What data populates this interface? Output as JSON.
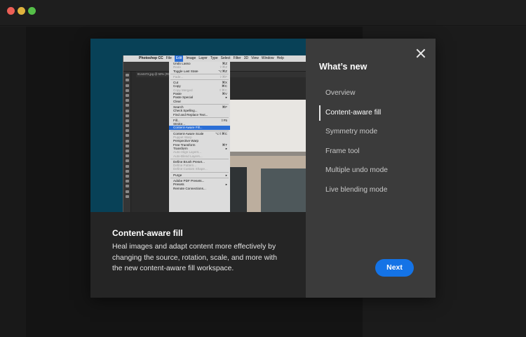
{
  "dialog": {
    "title": "What’s new",
    "nav": [
      {
        "label": "Overview",
        "active": false
      },
      {
        "label": "Content-aware fill",
        "active": true
      },
      {
        "label": "Symmetry mode",
        "active": false
      },
      {
        "label": "Frame tool",
        "active": false
      },
      {
        "label": "Multiple undo mode",
        "active": false
      },
      {
        "label": "Live blending mode",
        "active": false
      }
    ],
    "feature_title": "Content-aware fill",
    "feature_text": "Heal images and adapt content more effectively by changing the source, rotation, scale, and more with the new content-aware fill workspace.",
    "next_label": "Next",
    "accent_color": "#1473e6",
    "close_icon": "close-icon"
  },
  "preview": {
    "app_name": "Photoshop CC",
    "menubar": [
      "File",
      "Edit",
      "Image",
      "Layer",
      "Type",
      "Select",
      "Filter",
      "3D",
      "View",
      "Window",
      "Help"
    ],
    "selected_menu": "Edit",
    "doc_tab": "8144472.jpg @ 50% (RGB/8)",
    "edit_menu": [
      {
        "label": "Undo Lasso",
        "shortcut": "⌘Z",
        "state": "normal"
      },
      {
        "label": "Redo",
        "shortcut": "⇧⌘Z",
        "state": "disabled"
      },
      {
        "label": "Toggle Last State",
        "shortcut": "⌥⌘Z",
        "state": "normal"
      },
      {
        "sep": true
      },
      {
        "label": "Fade...",
        "shortcut": "⇧⌘F",
        "state": "disabled"
      },
      {
        "sep": true
      },
      {
        "label": "Cut",
        "shortcut": "⌘X",
        "state": "normal"
      },
      {
        "label": "Copy",
        "shortcut": "⌘C",
        "state": "normal"
      },
      {
        "label": "Copy Merged",
        "shortcut": "⇧⌘C",
        "state": "disabled"
      },
      {
        "label": "Paste",
        "shortcut": "⌘V",
        "state": "normal"
      },
      {
        "label": "Paste Special",
        "shortcut": "▸",
        "state": "normal"
      },
      {
        "label": "Clear",
        "shortcut": "",
        "state": "normal"
      },
      {
        "sep": true
      },
      {
        "label": "Search",
        "shortcut": "⌘F",
        "state": "normal"
      },
      {
        "label": "Check Spelling...",
        "shortcut": "",
        "state": "normal"
      },
      {
        "label": "Find and Replace Text...",
        "shortcut": "",
        "state": "normal"
      },
      {
        "sep": true
      },
      {
        "label": "Fill...",
        "shortcut": "⇧F5",
        "state": "normal"
      },
      {
        "label": "Stroke...",
        "shortcut": "",
        "state": "normal"
      },
      {
        "label": "Content-Aware Fill...",
        "shortcut": "",
        "state": "highlighted"
      },
      {
        "sep": true
      },
      {
        "label": "Content-Aware Scale",
        "shortcut": "⌥⇧⌘C",
        "state": "normal"
      },
      {
        "label": "Puppet Warp",
        "shortcut": "",
        "state": "disabled"
      },
      {
        "label": "Perspective Warp",
        "shortcut": "",
        "state": "normal"
      },
      {
        "label": "Free Transform",
        "shortcut": "⌘T",
        "state": "normal"
      },
      {
        "label": "Transform",
        "shortcut": "▸",
        "state": "normal"
      },
      {
        "label": "Auto-Align Layers...",
        "shortcut": "",
        "state": "disabled"
      },
      {
        "label": "Auto-Blend Layers...",
        "shortcut": "",
        "state": "disabled"
      },
      {
        "sep": true
      },
      {
        "label": "Define Brush Preset...",
        "shortcut": "",
        "state": "normal"
      },
      {
        "label": "Define Pattern...",
        "shortcut": "",
        "state": "disabled"
      },
      {
        "label": "Define Custom Shape...",
        "shortcut": "",
        "state": "disabled"
      },
      {
        "sep": true
      },
      {
        "label": "Purge",
        "shortcut": "▸",
        "state": "normal"
      },
      {
        "sep": true
      },
      {
        "label": "Adobe PDF Presets...",
        "shortcut": "",
        "state": "normal"
      },
      {
        "label": "Presets",
        "shortcut": "▸",
        "state": "normal"
      },
      {
        "label": "Remote Connections...",
        "shortcut": "",
        "state": "normal"
      }
    ]
  }
}
